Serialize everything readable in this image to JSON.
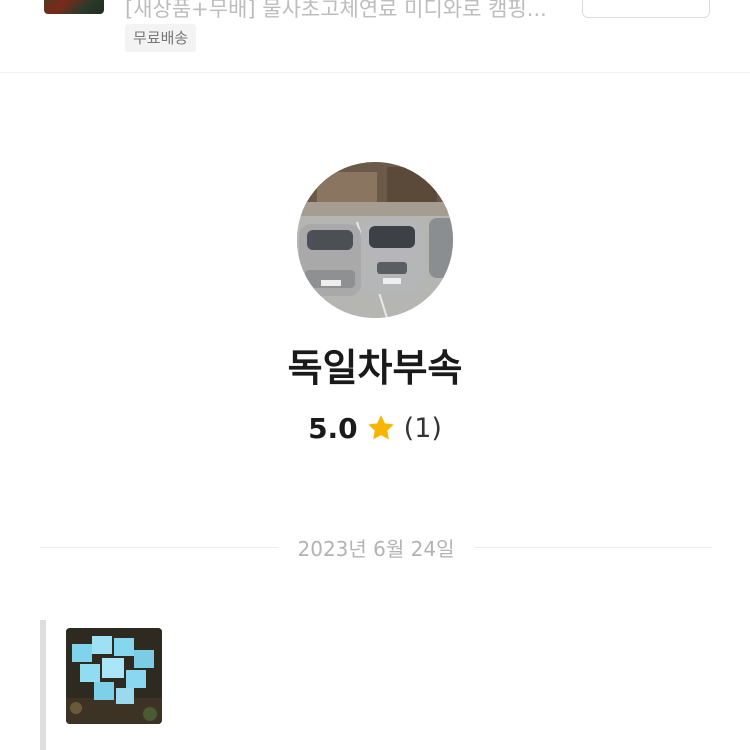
{
  "product": {
    "title": "[새상품+무배] 물사초고체연료 미디와로 캠핑...",
    "shipping_badge": "무료배송",
    "thumbnail_icon": "product-thumbnail",
    "action_button_label": ""
  },
  "seller": {
    "name": "독일차부속",
    "rating": "5.0",
    "review_count": "(1)",
    "avatar_icon": "seller-avatar-image",
    "star_icon": "star-icon",
    "star_color": "#f7b500"
  },
  "reviews": {
    "date": "2023년 6월 24일",
    "items": [
      {
        "image_icon": "review-photo"
      }
    ]
  }
}
